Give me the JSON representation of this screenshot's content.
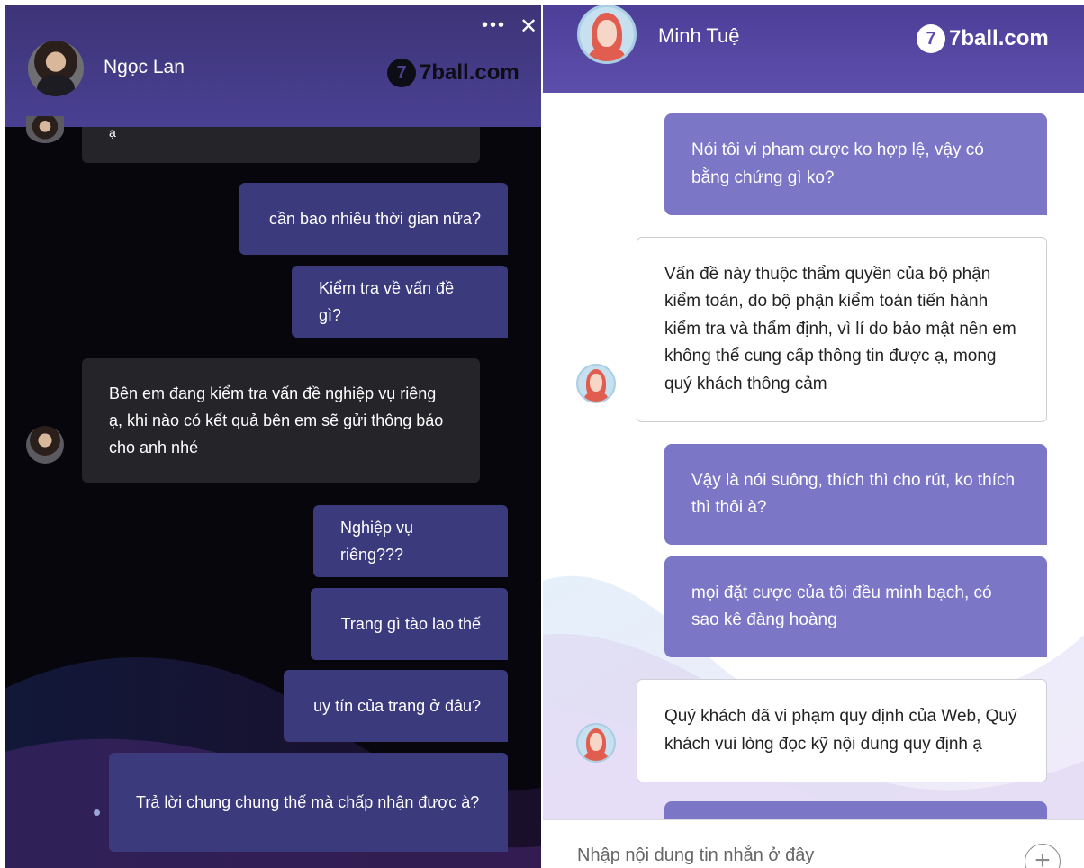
{
  "left": {
    "agent_name": "Ngọc Lan",
    "brand": "7ball.com",
    "brand_digit": "7",
    "more_icon": "•••",
    "close_icon": "✕",
    "messages": [
      {
        "from": "agent",
        "text": "ạ"
      },
      {
        "from": "user",
        "text": "cần bao nhiêu thời gian nữa?"
      },
      {
        "from": "user",
        "text": "Kiểm tra về vấn đề gì?"
      },
      {
        "from": "agent",
        "text": "Bên em đang kiểm tra vấn đề nghiệp vụ riêng ạ, khi nào có kết quả bên em sẽ gửi thông báo cho anh nhé"
      },
      {
        "from": "user",
        "text": "Nghiệp vụ riêng???"
      },
      {
        "from": "user",
        "text": "Trang gì tào lao thế"
      },
      {
        "from": "user",
        "text": "uy tín của trang ở đâu?"
      },
      {
        "from": "user",
        "text": "Trả lời chung chung thế mà chấp nhận được à?"
      }
    ]
  },
  "right": {
    "agent_name": "Minh Tuệ",
    "brand": "7ball.com",
    "brand_digit": "7",
    "messages": [
      {
        "from": "user",
        "text": "Nói tôi vi pham cược ko hợp lệ, vậy có bằng chứng gì ko?"
      },
      {
        "from": "agent",
        "text": "Vấn đề này thuộc thẩm quyền của bộ phận kiểm toán, do bộ phận kiểm toán tiến hành kiểm tra và thẩm định, vì lí do bảo mật nên em không thể cung cấp thông tin được ạ, mong quý khách thông cảm"
      },
      {
        "from": "user",
        "text": "Vậy là nói suông, thích thì cho rút, ko thích thì thôi à?"
      },
      {
        "from": "user",
        "text": "mọi đặt cược của tôi đều minh bạch, có sao kê đàng hoàng"
      },
      {
        "from": "agent",
        "text": "Quý khách đã vi phạm quy định của Web, Quý khách vui lòng đọc kỹ nội dung quy định ạ"
      }
    ],
    "composer": {
      "placeholder": "Nhập nội dung tin nhắn ở đây",
      "plus_icon": "+"
    }
  },
  "colors": {
    "left_header": "#4a4092",
    "left_bubble_out": "#3b3a7d",
    "left_bubble_in": "#242429",
    "right_header": "#5c4eab",
    "right_bubble_out": "#7b76c6",
    "right_bubble_in": "#ffffff"
  }
}
